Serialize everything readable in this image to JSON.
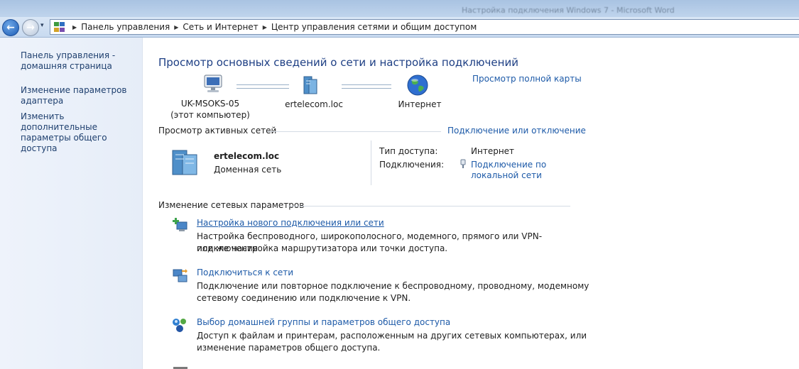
{
  "window": {
    "title": "Настройка подключения Windows 7 - Microsoft Word"
  },
  "nav": {
    "back_label": "←",
    "forward_label": "→",
    "history_label": "▾",
    "breadcrumbs": [
      "Панель управления",
      "Сеть и Интернет",
      "Центр управления сетями и общим доступом"
    ],
    "crumb_sep": "▶"
  },
  "sidebar": {
    "items": [
      {
        "label": "Панель управления - домашняя страница"
      },
      {
        "label": "Изменение параметров адаптера"
      },
      {
        "label": "Изменить дополнительные параметры общего доступа"
      }
    ]
  },
  "main": {
    "title": "Просмотр основных сведений о сети и настройка подключений",
    "full_map_link": "Просмотр полной карты",
    "map": {
      "computer_name": "UK-MSOKS-05",
      "computer_note": "(этот компьютер)",
      "domain_name": "ertelecom.loc",
      "internet_label": "Интернет"
    },
    "active_networks": {
      "heading": "Просмотр активных сетей",
      "connect_link": "Подключение или отключение",
      "network_name": "ertelecom.loc",
      "network_type": "Доменная сеть",
      "access_type_label": "Тип доступа:",
      "access_type_value": "Интернет",
      "connections_label": "Подключения:",
      "connection_link_line1": "Подключение по",
      "connection_link_line2": "локальной сети"
    },
    "change_settings": {
      "heading": "Изменение сетевых параметров",
      "tasks": [
        {
          "icon": "new-connection-icon",
          "link": "Настройка нового подключения или сети",
          "desc1": "Настройка беспроводного, широкополосного, модемного, прямого или VPN-подключения",
          "desc2": "или же настройка маршрутизатора или точки доступа."
        },
        {
          "icon": "connect-to-network-icon",
          "link": "Подключиться к сети",
          "desc1": "Подключение или повторное подключение к беспроводному, проводному, модемному",
          "desc2": "сетевому соединению или подключение к VPN."
        },
        {
          "icon": "homegroup-icon",
          "link": "Выбор домашней группы и параметров общего доступа",
          "desc1": "Доступ к файлам и принтерам, расположенным на других сетевых компьютерах, или",
          "desc2": "изменение параметров общего доступа."
        }
      ]
    }
  },
  "colors": {
    "link": "#1d5aa8",
    "title": "#1e3f84",
    "sidebar_bg": "#eef3fb",
    "navbar_bg": "#d9e6f5"
  }
}
